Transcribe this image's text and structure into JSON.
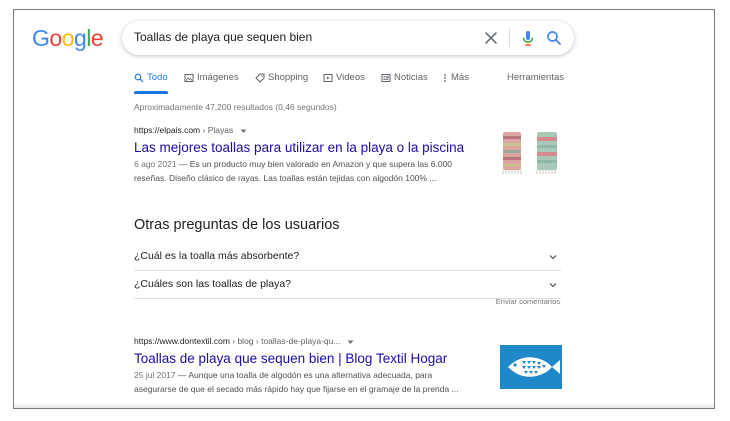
{
  "logo": {
    "letters": [
      "G",
      "o",
      "o",
      "g",
      "l",
      "e"
    ],
    "colors": [
      "#4285f4",
      "#ea4335",
      "#fbbc05",
      "#4285f4",
      "#34a853",
      "#ea4335"
    ]
  },
  "search": {
    "query": "Toallas de playa que sequen bien"
  },
  "tabs": [
    {
      "label": "Todo",
      "icon": "search-icon",
      "active": true
    },
    {
      "label": "Imágenes",
      "icon": "image-icon"
    },
    {
      "label": "Shopping",
      "icon": "tag-icon"
    },
    {
      "label": "Videos",
      "icon": "play-icon"
    },
    {
      "label": "Noticias",
      "icon": "news-icon"
    },
    {
      "label": "Más",
      "icon": "more-vert-icon"
    }
  ],
  "tools_label": "Herramientas",
  "stats": "Aproximadamente 47.200 resultados (0,46 segundos)",
  "results": [
    {
      "url": "https://elpais.com",
      "breadcrumb": " › Playas",
      "title": "Las mejores toallas para utilizar en la playa o la piscina",
      "date": "6 ago 2021",
      "snippet_line1": " — Es un producto muy bien valorado en Amazon y que supera las 6.000",
      "snippet_line2": "reseñas. Diseño clásico de rayas. Las toallas están tejidas con algodón 100% ..."
    },
    {
      "url": "https://www.dontextil.com",
      "breadcrumb": " › blog › toallas-de-playa-qu...",
      "title": "Toallas de playa que sequen bien | Blog Textil Hogar",
      "date": "25 jul 2017",
      "snippet_line1": " — Aunque una toalla de algodón es una alternativa adecuada, para",
      "snippet_line2": "asegurarse de que el secado más rápido hay que fijarse en el gramaje de la prenda ..."
    }
  ],
  "paa": {
    "title": "Otras preguntas de los usuarios",
    "questions": [
      "¿Cuál es la toalla más absorbente?",
      "¿Cuáles son las toallas de playa?"
    ]
  },
  "feedback": "Enviar comentarios",
  "colors": {
    "link": "#1a0dab",
    "accent": "#1a73e8",
    "thumb2_bg": "#1e88c8"
  }
}
